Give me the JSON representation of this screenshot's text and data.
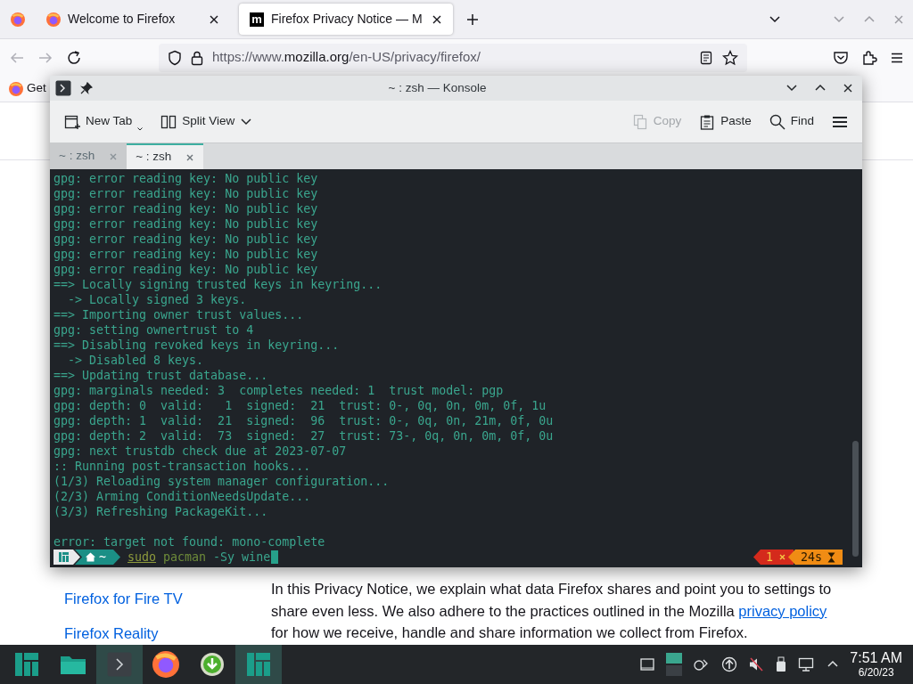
{
  "firefox": {
    "tabs": [
      {
        "title": "Welcome to Firefox",
        "selected": false,
        "kind": "firefox"
      },
      {
        "title": "Firefox Privacy Notice — M",
        "selected": true,
        "kind": "mozilla",
        "icon_text": "m"
      }
    ],
    "address": {
      "prefix": "https://www.",
      "domain": "mozilla.org",
      "path": "/en-US/privacy/firefox/"
    },
    "bookmarks": [
      {
        "label": "Get"
      }
    ],
    "page": {
      "sidebar_links": [
        "Firefox for Fire TV",
        "Firefox Reality"
      ],
      "paragraph": {
        "before": "In this Privacy Notice, we explain what data Firefox shares and point you to settings to share even less. We also adhere to the practices outlined in the Mozilla ",
        "link": "privacy policy",
        "after": " for how we receive, handle and share information we collect from Firefox."
      }
    }
  },
  "konsole": {
    "title": "~ : zsh — Konsole",
    "toolbar": [
      {
        "kind": "new-tab",
        "label": "New Tab",
        "disabled": false
      },
      {
        "kind": "split",
        "label": "Split View",
        "disabled": false
      },
      {
        "kind": "copy",
        "label": "Copy",
        "disabled": true
      },
      {
        "kind": "paste",
        "label": "Paste",
        "disabled": false
      },
      {
        "kind": "find",
        "label": "Find",
        "disabled": false
      }
    ],
    "tabs": [
      {
        "label": "~ : zsh",
        "selected": false
      },
      {
        "label": "~ : zsh",
        "selected": true
      }
    ],
    "output": [
      "gpg: error reading key: No public key",
      "gpg: error reading key: No public key",
      "gpg: error reading key: No public key",
      "gpg: error reading key: No public key",
      "gpg: error reading key: No public key",
      "gpg: error reading key: No public key",
      "gpg: error reading key: No public key",
      "==> Locally signing trusted keys in keyring...",
      "  -> Locally signed 3 keys.",
      "==> Importing owner trust values...",
      "gpg: setting ownertrust to 4",
      "==> Disabling revoked keys in keyring...",
      "  -> Disabled 8 keys.",
      "==> Updating trust database...",
      "gpg: marginals needed: 3  completes needed: 1  trust model: pgp",
      "gpg: depth: 0  valid:   1  signed:  21  trust: 0-, 0q, 0n, 0m, 0f, 1u",
      "gpg: depth: 1  valid:  21  signed:  96  trust: 0-, 0q, 0n, 21m, 0f, 0u",
      "gpg: depth: 2  valid:  73  signed:  27  trust: 73-, 0q, 0n, 0m, 0f, 0u",
      "gpg: next trustdb check due at 2023-07-07",
      ":: Running post-transaction hooks...",
      "(1/3) Reloading system manager configuration...",
      "(2/3) Arming ConditionNeedsUpdate...",
      "(3/3) Refreshing PackageKit..."
    ],
    "error": "error: target not found: mono-complete",
    "prompt": {
      "path": "~",
      "command": [
        {
          "kind": "sudo",
          "text": "sudo"
        },
        {
          "kind": "program",
          "text": "pacman"
        },
        {
          "kind": "args",
          "text": "-Sy wine"
        }
      ]
    },
    "status": {
      "exit_code": "1",
      "duration": "24s"
    }
  },
  "taskbar": {
    "apps": [
      {
        "kind": "launcher",
        "active": false
      },
      {
        "kind": "files",
        "active": false
      },
      {
        "kind": "terminal",
        "active": true
      },
      {
        "kind": "firefox",
        "active": false
      },
      {
        "kind": "download",
        "active": false
      },
      {
        "kind": "manjaro",
        "active": true
      }
    ],
    "clock": {
      "time": "7:51 AM",
      "date": "6/20/23"
    }
  }
}
